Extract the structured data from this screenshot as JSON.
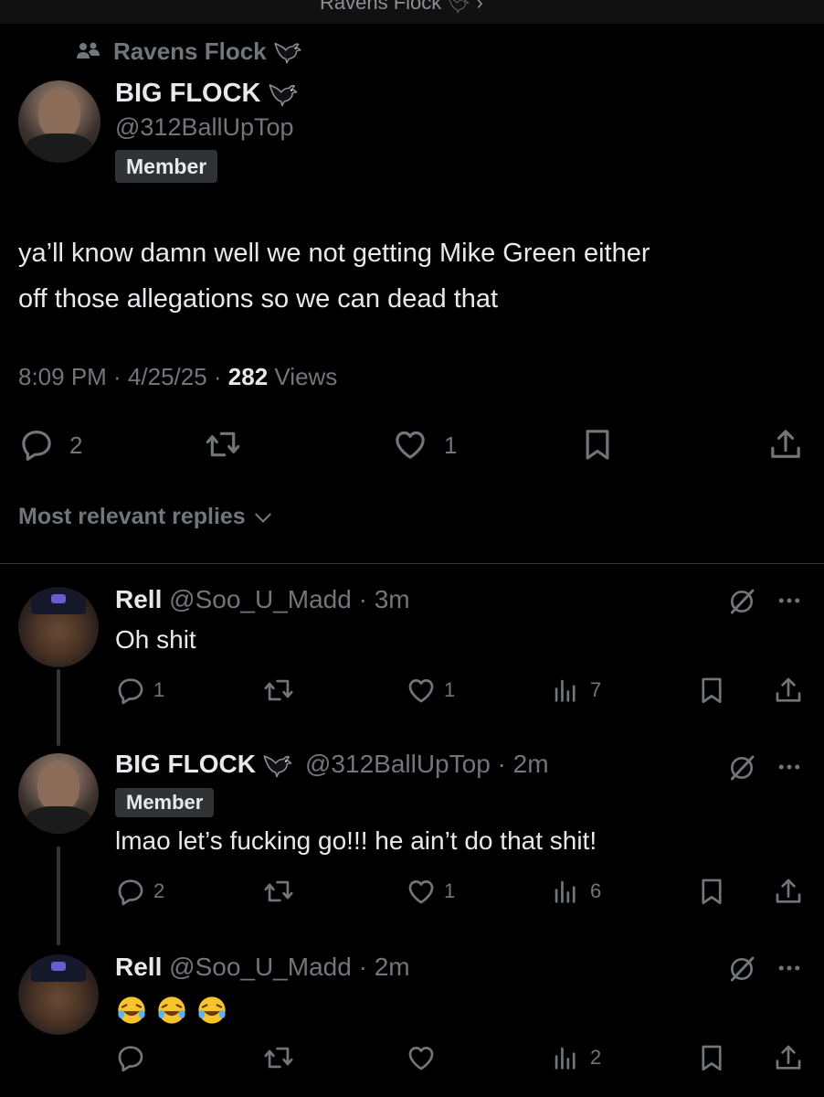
{
  "topbar": {
    "community": "Ravens Flock"
  },
  "post": {
    "community_label": "Ravens Flock",
    "author_name": "BIG FLOCK",
    "author_handle": "@312BallUpTop",
    "badge": "Member",
    "text_line1": "ya’ll know damn well we not getting Mike Green either",
    "text_line2": "off those allegations so we can dead that",
    "time": "8:09 PM",
    "date": "4/25/25",
    "views_count": "282",
    "views_label": "Views",
    "replies": "2",
    "likes": "1"
  },
  "replies_filter": "Most relevant replies",
  "replies": [
    {
      "name": "Rell",
      "handle": "@Soo_U_Madd",
      "age": "3m",
      "text": "Oh shit",
      "replies": "1",
      "likes": "1",
      "views": "7"
    },
    {
      "name": "BIG FLOCK",
      "handle": "@312BallUpTop",
      "age": "2m",
      "badge": "Member",
      "text": "lmao let’s fucking go!!! he ain’t do that shit!",
      "replies": "2",
      "likes": "1",
      "views": "6"
    },
    {
      "name": "Rell",
      "handle": "@Soo_U_Madd",
      "age": "2m",
      "text": "🤣🤣🤣",
      "views": "2"
    }
  ],
  "icons": {
    "reply": "reply-bubble-icon",
    "retweet": "retweet-icon",
    "like": "heart-icon",
    "views": "views-bars-icon",
    "bookmark": "bookmark-icon",
    "share": "share-icon",
    "grok": "grok-icon",
    "more": "more-dots-icon",
    "community": "community-people-icon",
    "bird": "raven-emoji-icon"
  },
  "colors": {
    "background": "#000000",
    "text": "#e7e9ea",
    "secondary": "#71767b",
    "badge_bg": "#2f3336"
  }
}
